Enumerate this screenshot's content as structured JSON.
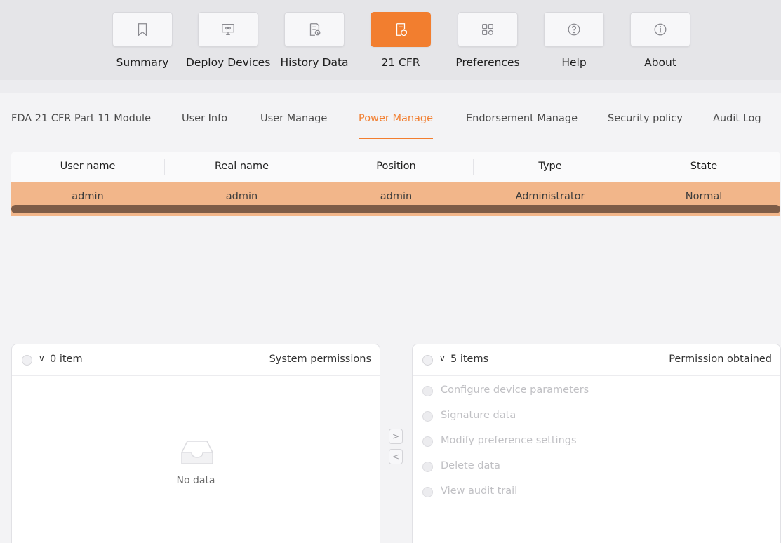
{
  "toolbar": {
    "items": [
      {
        "label": "Summary",
        "icon": "bookmark-icon"
      },
      {
        "label": "Deploy Devices",
        "icon": "monitor-icon"
      },
      {
        "label": "History Data",
        "icon": "document-clock-icon"
      },
      {
        "label": "21 CFR",
        "icon": "document-shield-icon",
        "active": true
      },
      {
        "label": "Preferences",
        "icon": "grid-icon"
      },
      {
        "label": "Help",
        "icon": "question-icon"
      },
      {
        "label": "About",
        "icon": "info-icon"
      }
    ]
  },
  "tabs": [
    {
      "label": "FDA 21 CFR Part 11 Module"
    },
    {
      "label": "User Info"
    },
    {
      "label": "User Manage"
    },
    {
      "label": "Power Manage",
      "active": true
    },
    {
      "label": "Endorsement Manage"
    },
    {
      "label": "Security policy"
    },
    {
      "label": "Audit Log"
    }
  ],
  "table": {
    "headers": [
      "User name",
      "Real name",
      "Position",
      "Type",
      "State"
    ],
    "rows": [
      [
        "admin",
        "admin",
        "admin",
        "Administrator",
        "Normal"
      ]
    ]
  },
  "left_panel": {
    "count": "0 item",
    "title": "System permissions",
    "empty_text": "No data"
  },
  "right_panel": {
    "count": "5 items",
    "title": "Permission obtained",
    "items": [
      "Configure device parameters",
      "Signature data",
      "Modify preference settings",
      "Delete data",
      "View audit trail"
    ]
  },
  "transfer": {
    "right": ">",
    "left": "<"
  },
  "colors": {
    "accent": "#f27e2f",
    "selected_row": "#f2b68a",
    "scrollbar": "#7e5c47"
  }
}
